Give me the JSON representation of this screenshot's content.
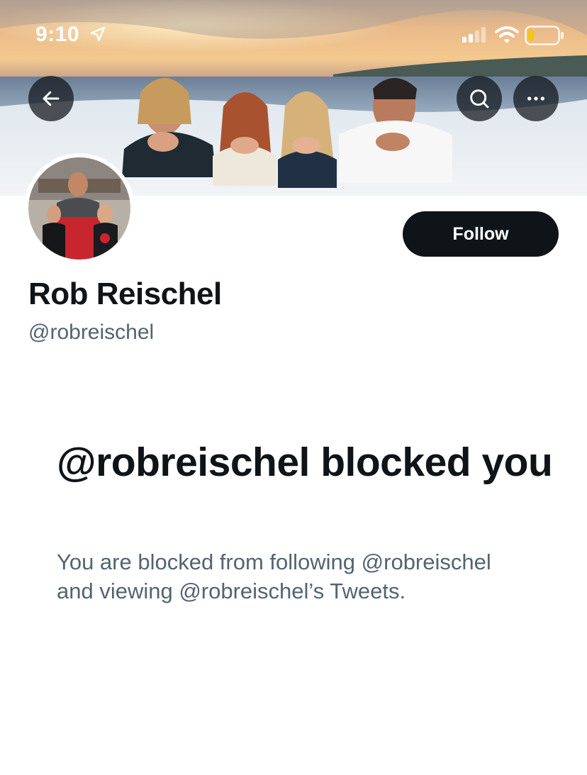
{
  "status_bar": {
    "time": "9:10"
  },
  "header": {
    "back_icon": "arrow-left-icon",
    "search_icon": "search-icon",
    "more_icon": "more-horizontal-icon"
  },
  "profile": {
    "display_name": "Rob Reischel",
    "handle": "@robreischel",
    "follow_label": "Follow"
  },
  "blocked": {
    "title": "@robreischel blocked you",
    "description": "You are blocked from following @robreischel and viewing @robreischel’s Tweets."
  },
  "colors": {
    "primary_text": "#0f1419",
    "secondary_text": "#536471",
    "button_bg": "#0f1419",
    "battery_level": "#f5c518"
  },
  "battery": {
    "level_fraction": 0.2
  }
}
